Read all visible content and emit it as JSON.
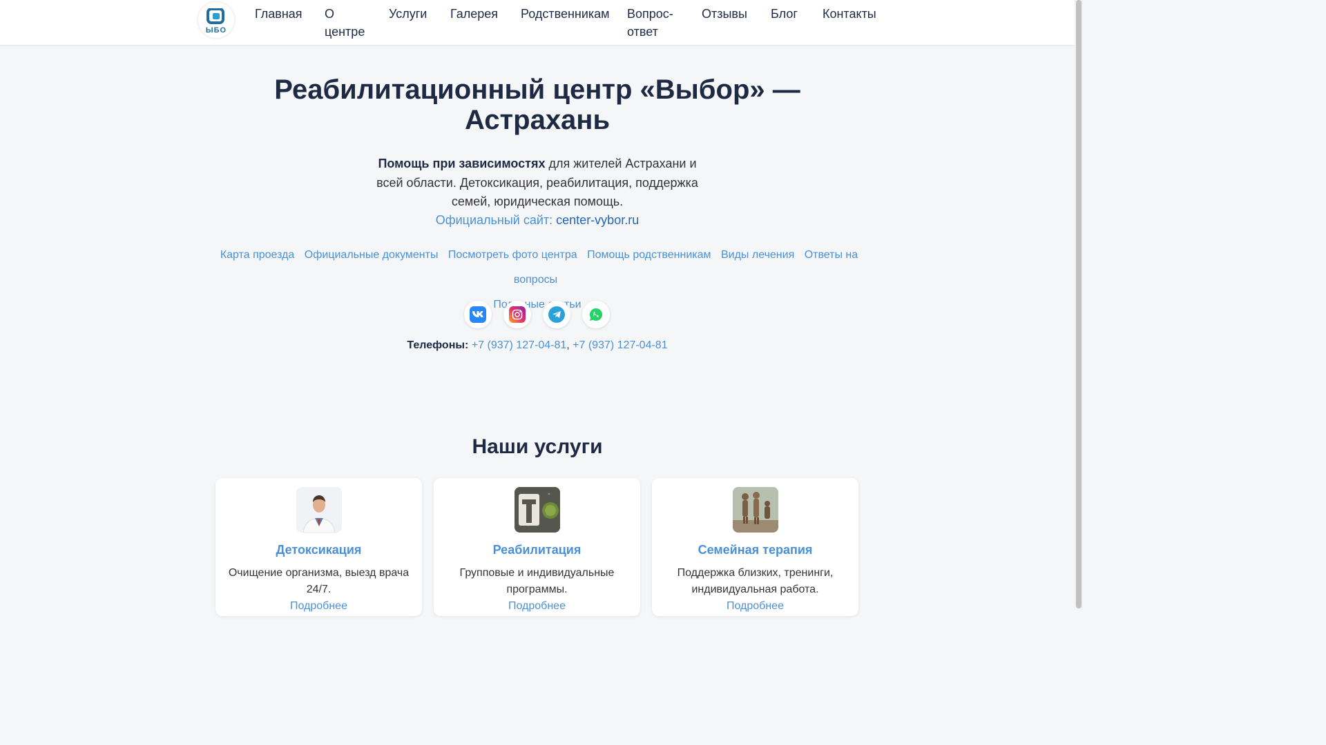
{
  "header": {
    "logo_text": "ЫБО",
    "nav": [
      "Главная",
      "О центре",
      "Услуги",
      "Галерея",
      "Родственникам",
      "Вопрос-ответ",
      "Отзывы",
      "Блог",
      "Контакты"
    ]
  },
  "hero": {
    "title": "Реабилитационный центр «Выбор» — Астрахань",
    "desc_bold": "Помощь при зависимостях",
    "desc_rest": " для жителей Астрахани и всей области. Детоксикация, реабилитация, поддержка семей, юридическая помощь.",
    "site_label": "Официальный сайт: ",
    "site_domain": "center-vybor.ru",
    "quick_links": [
      "Карта проезда",
      "Официальные документы",
      "Посмотреть фото центра",
      "Помощь родственникам",
      "Виды лечения",
      "Ответы на вопросы",
      "Полезные статьи"
    ],
    "socials": [
      {
        "name": "vk-icon",
        "color": "#2787f5"
      },
      {
        "name": "instagram-icon",
        "color": "#e1306c"
      },
      {
        "name": "telegram-icon",
        "color": "#2aa1da"
      },
      {
        "name": "whatsapp-icon",
        "color": "#25d366"
      }
    ],
    "phones_label": "Телефоны:",
    "phone_1": "+7 (937) 127-04-81",
    "phone_sep": ",",
    "phone_2": "+7 (937) 127-04-81"
  },
  "services": {
    "title": "Наши услуги",
    "cards": [
      {
        "title": "Детоксикация",
        "text": "Очищение организма, выезд врача 24/7.",
        "more": "Подробнее"
      },
      {
        "title": "Реабилитация",
        "text": "Групповые и индивидуальные программы.",
        "more": "Подробнее"
      },
      {
        "title": "Семейная терапия",
        "text": "Поддержка близких, тренинги, индивидуальная работа.",
        "more": "Подробнее"
      }
    ]
  },
  "colors": {
    "accent": "#4a90d9",
    "heading": "#1e2a44"
  }
}
